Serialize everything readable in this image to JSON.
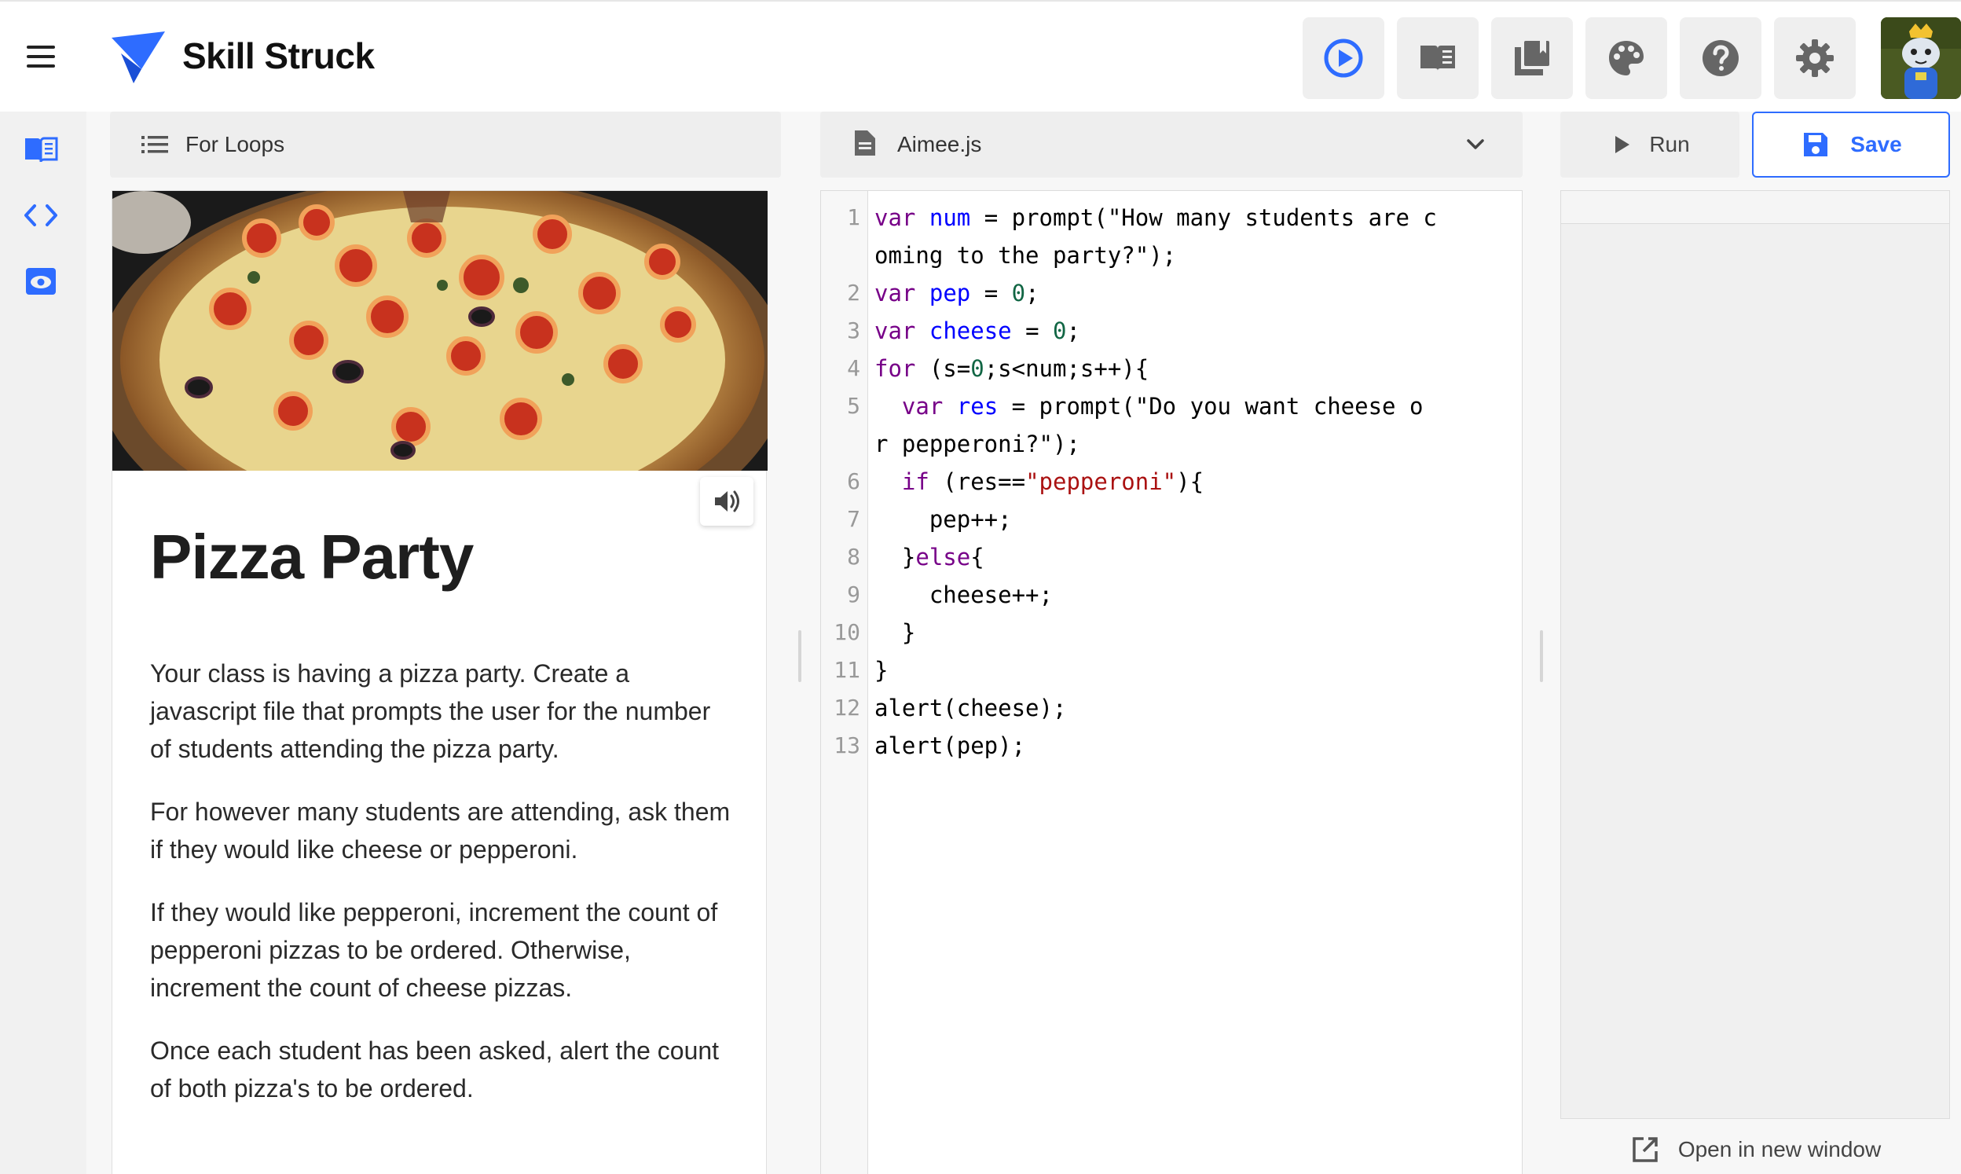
{
  "header": {
    "brand": "Skill Struck",
    "accent_color": "#2e6cff",
    "toolbar": [
      {
        "name": "play-circle-icon"
      },
      {
        "name": "book-open-icon"
      },
      {
        "name": "library-icon"
      },
      {
        "name": "palette-icon"
      },
      {
        "name": "help-icon"
      },
      {
        "name": "gear-icon"
      }
    ]
  },
  "rail": {
    "items": [
      {
        "name": "lesson-book-icon",
        "active": true
      },
      {
        "name": "code-icon"
      },
      {
        "name": "preview-eye-icon"
      }
    ]
  },
  "lesson": {
    "section_title": "For Loops",
    "heading": "Pizza Party",
    "paragraphs": [
      "Your class is having a pizza party. Create a javascript file that prompts the user for the number of students attending the pizza party.",
      "For however many students are attending, ask them if they would like cheese or pepperoni.",
      "If they would like pepperoni, increment the count of pepperoni pizzas to be ordered. Otherwise, increment the count of cheese pizzas.",
      "Once each student has been asked, alert the count of both pizza's to be ordered."
    ]
  },
  "editor": {
    "file_name": "Aimee.js",
    "lines": [
      "var num = prompt(\"How many students are coming to the party?\");",
      "var pep = 0;",
      "var cheese = 0;",
      "for (s=0;s<num;s++){",
      "  var res = prompt(\"Do you want cheese or pepperoni?\");",
      "  if (res==\"pepperoni\"){",
      "    pep++;",
      "  }else{",
      "    cheese++;",
      "  }",
      "}",
      "alert(cheese);",
      "alert(pep);"
    ]
  },
  "output": {
    "run_label": "Run",
    "save_label": "Save",
    "open_window_label": "Open in new window"
  }
}
